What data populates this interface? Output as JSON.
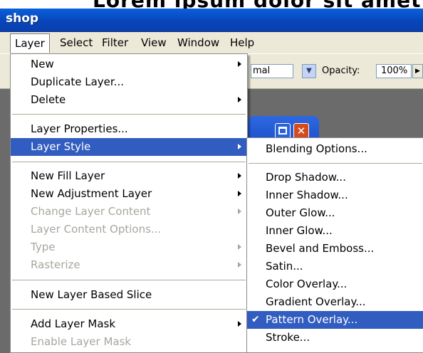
{
  "title": "shop",
  "menubar": {
    "items": [
      {
        "label": "Layer"
      },
      {
        "label": "Select"
      },
      {
        "label": "Filter"
      },
      {
        "label": "View"
      },
      {
        "label": "Window"
      },
      {
        "label": "Help"
      }
    ]
  },
  "options_bar": {
    "mode_value": "mal",
    "opacity_label": "Opacity:",
    "opacity_value": "100%"
  },
  "layer_menu": {
    "items": [
      {
        "label": "New",
        "submenu": true,
        "disabled": false
      },
      {
        "label": "Duplicate Layer...",
        "submenu": false,
        "disabled": false
      },
      {
        "label": "Delete",
        "submenu": true,
        "disabled": false
      },
      {
        "label": "Layer Properties...",
        "submenu": false,
        "disabled": false
      },
      {
        "label": "Layer Style",
        "submenu": true,
        "disabled": false,
        "selected": true
      },
      {
        "label": "New Fill Layer",
        "submenu": true,
        "disabled": false
      },
      {
        "label": "New Adjustment Layer",
        "submenu": true,
        "disabled": false
      },
      {
        "label": "Change Layer Content",
        "submenu": true,
        "disabled": true
      },
      {
        "label": "Layer Content Options...",
        "submenu": false,
        "disabled": true
      },
      {
        "label": "Type",
        "submenu": true,
        "disabled": true
      },
      {
        "label": "Rasterize",
        "submenu": true,
        "disabled": true
      },
      {
        "label": "New Layer Based Slice",
        "submenu": false,
        "disabled": false
      },
      {
        "label": "Add Layer Mask",
        "submenu": true,
        "disabled": false
      },
      {
        "label": "Enable Layer Mask",
        "submenu": false,
        "disabled": true
      }
    ]
  },
  "layer_style_menu": {
    "items": [
      {
        "label": "Blending Options..."
      },
      {
        "label": "Drop Shadow..."
      },
      {
        "label": "Inner Shadow..."
      },
      {
        "label": "Outer Glow..."
      },
      {
        "label": "Inner Glow..."
      },
      {
        "label": "Bevel and Emboss..."
      },
      {
        "label": "Satin..."
      },
      {
        "label": "Color Overlay..."
      },
      {
        "label": "Gradient Overlay..."
      },
      {
        "label": "Pattern Overlay...",
        "checked": true,
        "selected": true
      },
      {
        "label": "Stroke..."
      }
    ]
  },
  "colors": {
    "titlebar": "#0846b9",
    "highlight": "#315cc0",
    "menu_bg": "#ece9d8",
    "disabled_text": "#a7a69f",
    "close_button": "#d64b1e"
  }
}
